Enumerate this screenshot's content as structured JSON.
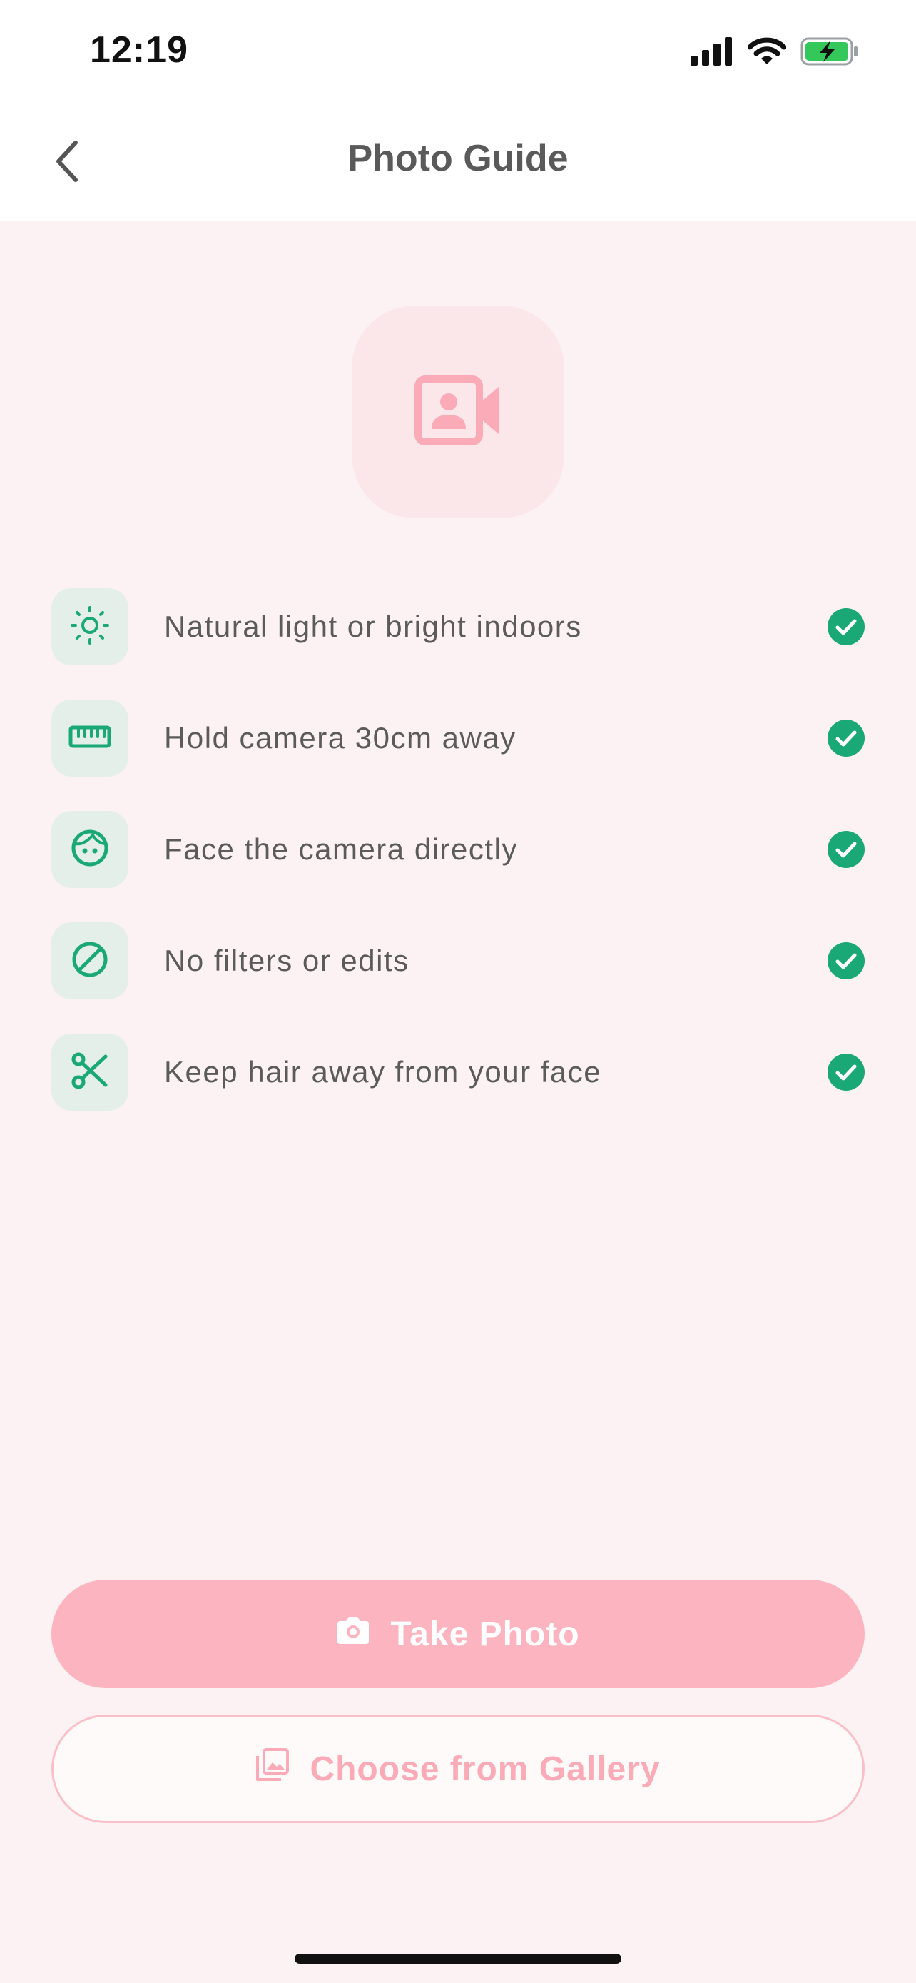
{
  "status_bar": {
    "time": "12:19",
    "icons": [
      "signal-icon",
      "wifi-icon",
      "battery-charging-icon"
    ]
  },
  "header": {
    "back_icon": "chevron-left-icon",
    "title": "Photo Guide"
  },
  "hero": {
    "icon": "video-portrait-icon"
  },
  "tips": [
    {
      "icon": "sun-icon",
      "label": "Natural light or bright indoors",
      "checked": true
    },
    {
      "icon": "ruler-icon",
      "label": "Hold camera 30cm away",
      "checked": true
    },
    {
      "icon": "face-icon",
      "label": "Face the camera directly",
      "checked": true
    },
    {
      "icon": "no-filter-icon",
      "label": "No filters or edits",
      "checked": true
    },
    {
      "icon": "scissors-icon",
      "label": "Keep hair away from your face",
      "checked": true
    }
  ],
  "actions": {
    "take_photo": {
      "icon": "camera-icon",
      "label": "Take Photo"
    },
    "gallery": {
      "icon": "gallery-icon",
      "label": "Choose from Gallery"
    }
  },
  "colors": {
    "accent_green": "#1aa877",
    "accent_pink": "#fcb5c0",
    "background": "#fcf2f3"
  }
}
